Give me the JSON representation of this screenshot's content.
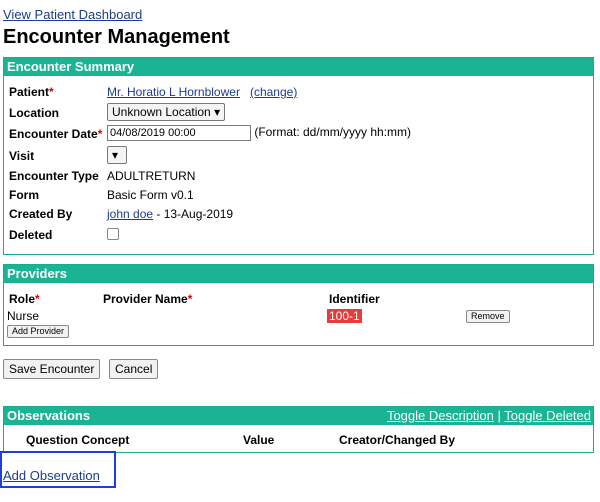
{
  "nav": {
    "dashboard_link": "View Patient Dashboard"
  },
  "page": {
    "title": "Encounter Management"
  },
  "summary": {
    "header": "Encounter Summary",
    "rows": {
      "patient_label": "Patient",
      "patient_value": "Mr. Horatio L Hornblower",
      "patient_change": "(change)",
      "location_label": "Location",
      "location_value": "Unknown Location",
      "date_label": "Encounter Date",
      "date_value": "04/08/2019 00:00",
      "date_format": "(Format: dd/mm/yyyy hh:mm)",
      "visit_label": "Visit",
      "type_label": "Encounter Type",
      "type_value": "ADULTRETURN",
      "form_label": "Form",
      "form_value": "Basic Form v0.1",
      "created_label": "Created By",
      "created_user": "john doe",
      "created_date": " - 13-Aug-2019",
      "deleted_label": "Deleted"
    }
  },
  "providers": {
    "header": "Providers",
    "col_role": "Role",
    "col_name": "Provider Name",
    "col_identifier": "Identifier",
    "row": {
      "role": "Nurse",
      "identifier": "100-1",
      "remove": "Remove"
    },
    "add_button": "Add Provider"
  },
  "actions": {
    "save": "Save Encounter",
    "cancel": "Cancel"
  },
  "observations": {
    "header": "Observations",
    "toggle_description": "Toggle Description",
    "separator": " | ",
    "toggle_deleted": "Toggle Deleted",
    "col_question": "Question Concept",
    "col_value": "Value",
    "col_creator": "Creator/Changed By",
    "add_link": "Add Observation"
  },
  "colors": {
    "header_bg": "#1ab394",
    "required": "#dd0000",
    "identifier_highlight": "#e83b3b",
    "focus": "#1f3ee0"
  },
  "icons": {
    "dropdown": "chevron-down-icon"
  }
}
